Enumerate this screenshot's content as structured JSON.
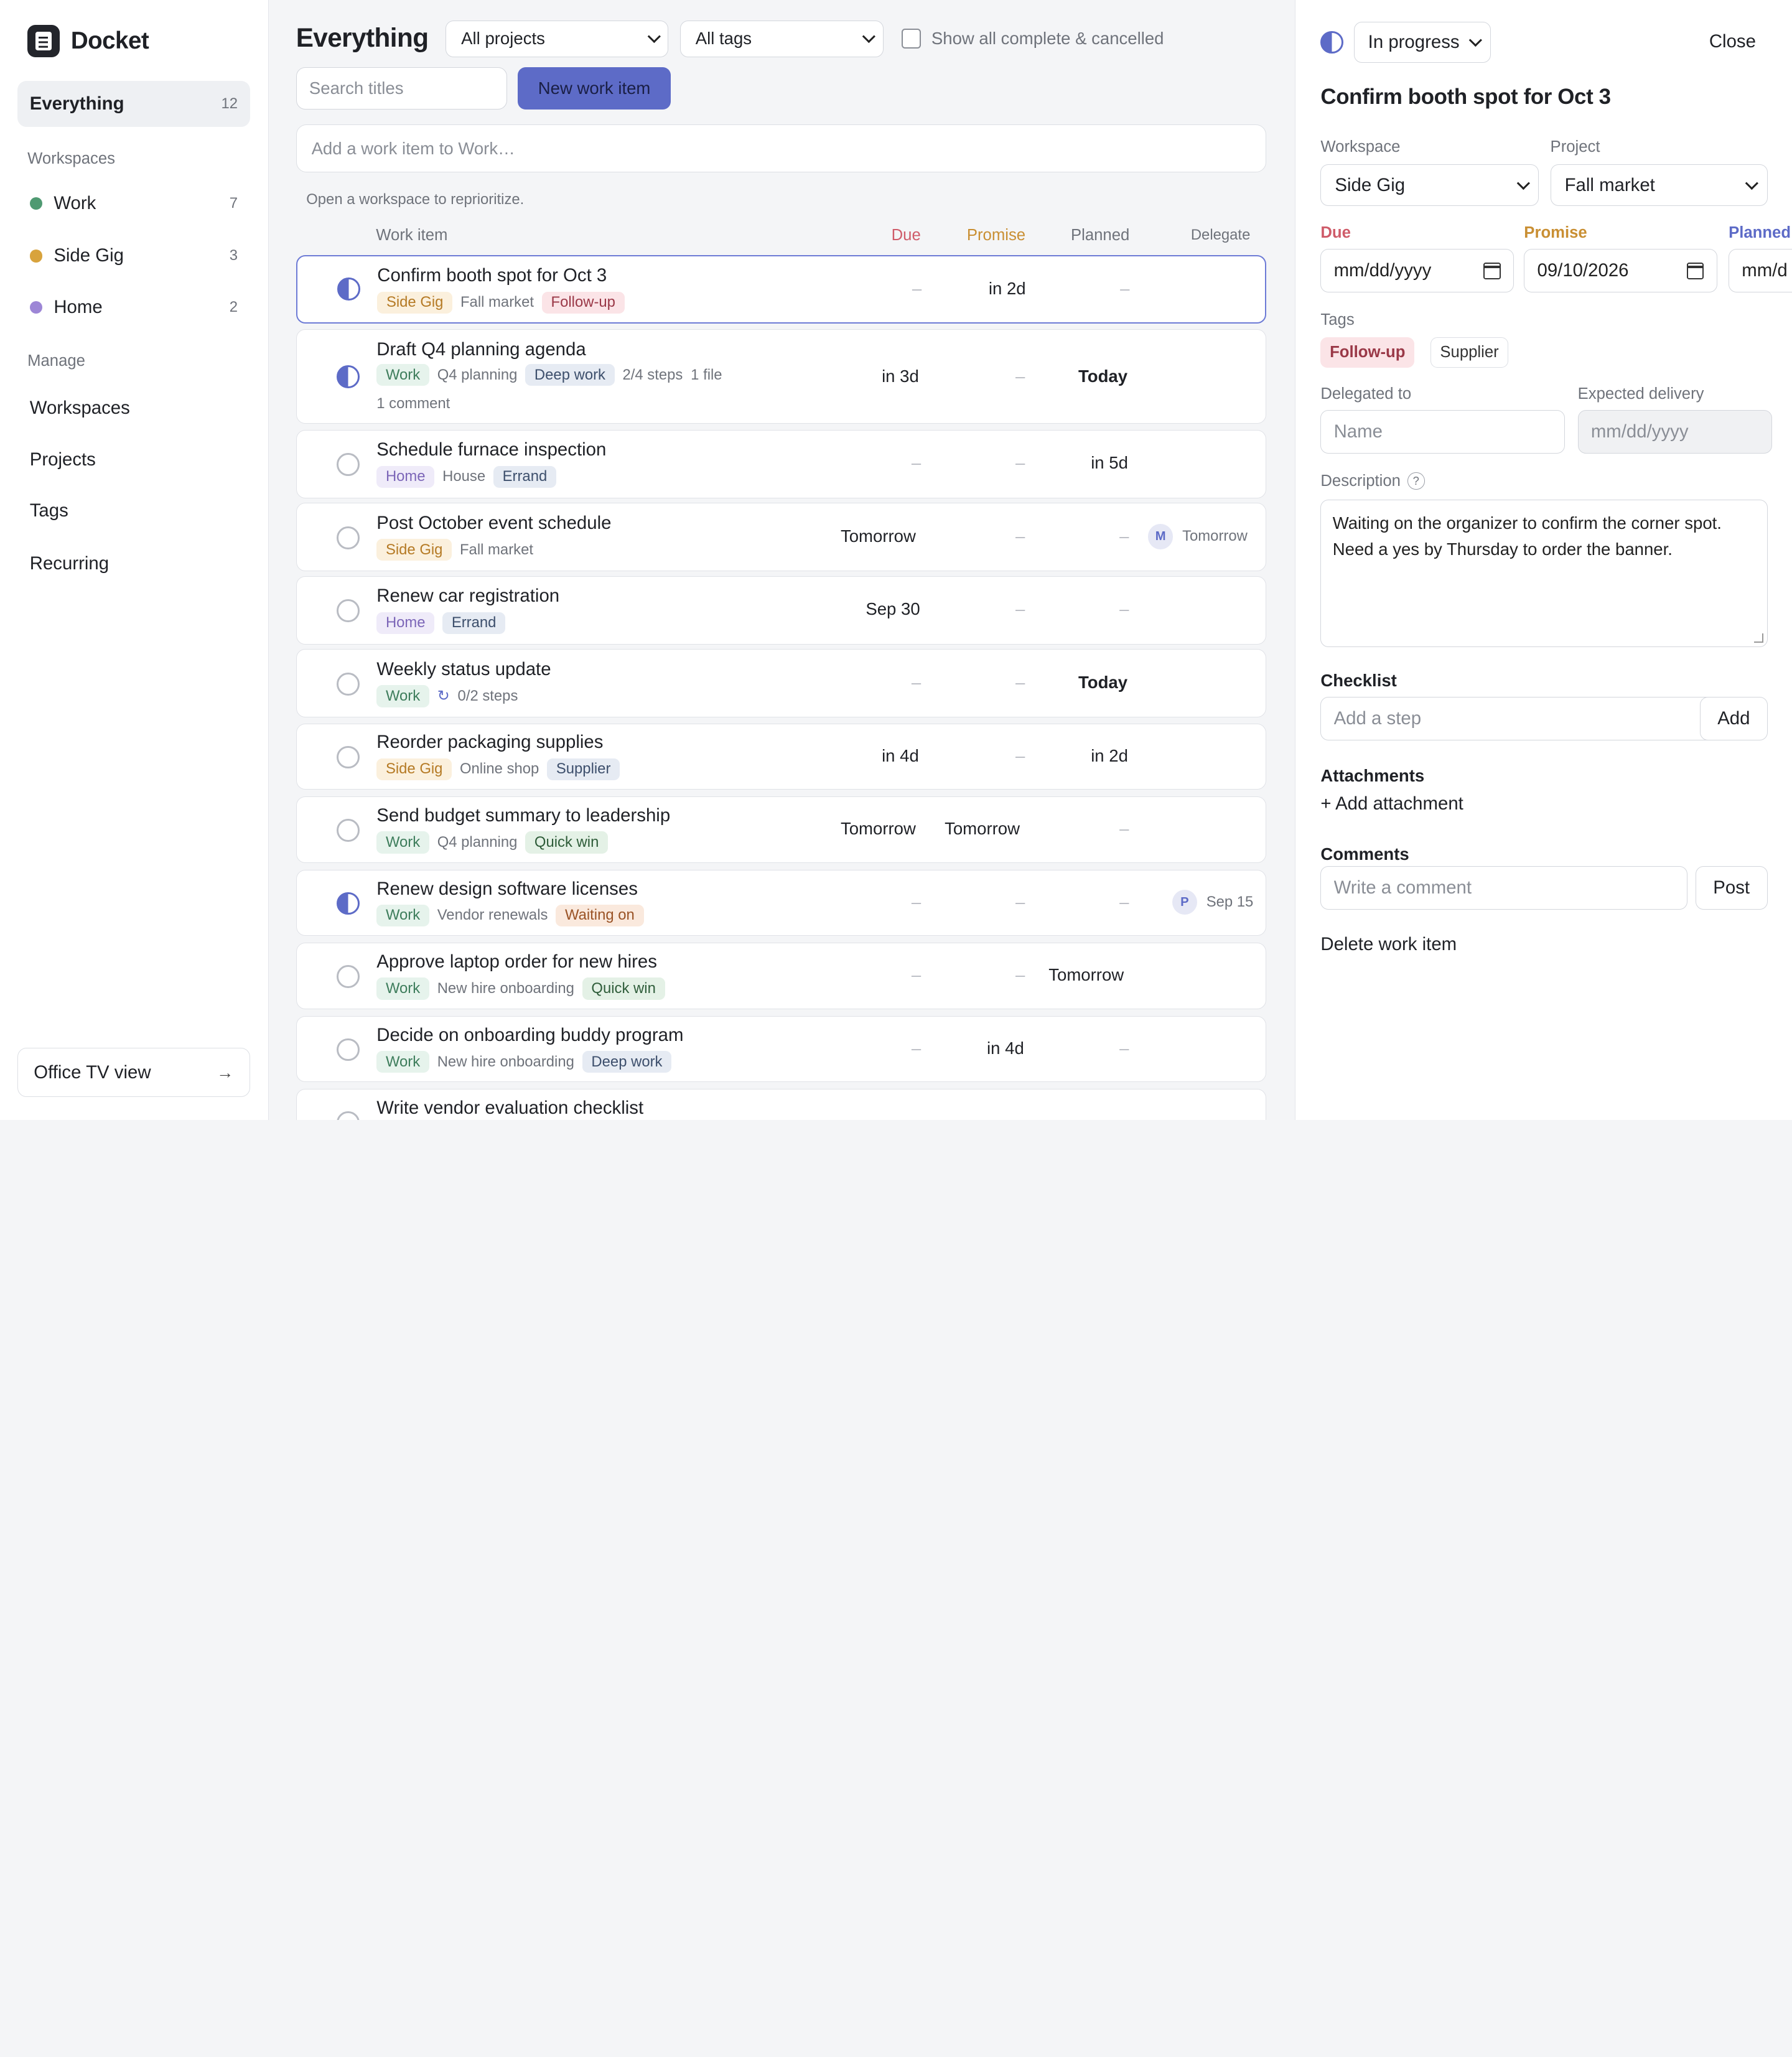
{
  "app": {
    "name": "Docket"
  },
  "sidebar": {
    "everything": {
      "label": "Everything",
      "count": "12"
    },
    "workspaces_title": "Workspaces",
    "workspaces": [
      {
        "label": "Work",
        "count": "7",
        "color": "#4f9a72"
      },
      {
        "label": "Side Gig",
        "count": "3",
        "color": "#d8a33d"
      },
      {
        "label": "Home",
        "count": "2",
        "color": "#9d86d6"
      }
    ],
    "manage_title": "Manage",
    "manage": [
      "Workspaces",
      "Projects",
      "Tags",
      "Recurring"
    ],
    "tv_view": {
      "label": "Office TV view",
      "arrow": "→"
    }
  },
  "main": {
    "title": "Everything",
    "project_filter": "All projects",
    "tag_filter": "All tags",
    "show_complete_label": "Show all complete & cancelled",
    "search_placeholder": "Search titles",
    "new_button": "New work item",
    "add_placeholder": "Add a work item to Work…",
    "hint": "Open a workspace to reprioritize.",
    "columns": {
      "work_item": "Work item",
      "due": "Due",
      "promise": "Promise",
      "planned": "Planned",
      "delegate": "Delegate"
    },
    "rows": [
      {
        "title": "Confirm booth spot for Oct 3",
        "workspace": "Side Gig",
        "project": "Fall market",
        "tags": [
          "Follow-up"
        ],
        "extra": "",
        "due": "–",
        "promise": "in 2d",
        "planned": "–",
        "delegate": "",
        "delegate_date": ""
      },
      {
        "title": "Draft Q4 planning agenda",
        "workspace": "Work",
        "project": "Q4 planning",
        "tags": [
          "Deep work"
        ],
        "extra": "2/4 steps",
        "extra2": "1 file",
        "extra3": "1 comment",
        "due": "in 3d",
        "promise": "–",
        "planned": "Today",
        "delegate": "",
        "delegate_date": ""
      },
      {
        "title": "Schedule furnace inspection",
        "workspace": "Home",
        "project": "House",
        "tags": [
          "Errand"
        ],
        "due": "–",
        "promise": "–",
        "planned": "in 5d"
      },
      {
        "title": "Post October event schedule",
        "workspace": "Side Gig",
        "project": "Fall market",
        "tags": [],
        "due": "Tomorrow",
        "promise": "–",
        "planned": "–",
        "delegate": "M",
        "delegate_date": "Tomorrow"
      },
      {
        "title": "Renew car registration",
        "workspace": "Home",
        "project": "",
        "tags": [
          "Errand"
        ],
        "due": "Sep 30",
        "promise": "–",
        "planned": "–"
      },
      {
        "title": "Weekly status update",
        "workspace": "Work",
        "recur_icon": "↻",
        "extra": "0/2 steps",
        "due": "–",
        "promise": "–",
        "planned": "Today"
      },
      {
        "title": "Reorder packaging supplies",
        "workspace": "Side Gig",
        "project": "Online shop",
        "tags": [
          "Supplier"
        ],
        "due": "in 4d",
        "promise": "–",
        "planned": "in 2d"
      },
      {
        "title": "Send budget summary to leadership",
        "workspace": "Work",
        "project": "Q4 planning",
        "tags": [
          "Quick win"
        ],
        "due": "Tomorrow",
        "promise": "Tomorrow",
        "planned": "–"
      },
      {
        "title": "Renew design software licenses",
        "workspace": "Work",
        "project": "Vendor renewals",
        "tags": [
          "Waiting on"
        ],
        "due": "–",
        "promise": "–",
        "planned": "–",
        "delegate": "P",
        "delegate_date": "Sep 15"
      },
      {
        "title": "Approve laptop order for new hires",
        "workspace": "Work",
        "project": "New hire onboarding",
        "tags": [
          "Quick win"
        ],
        "due": "–",
        "promise": "–",
        "planned": "Tomorrow"
      },
      {
        "title": "Decide on onboarding buddy program",
        "workspace": "Work",
        "project": "New hire onboarding",
        "tags": [
          "Deep work"
        ],
        "due": "–",
        "promise": "in 4d",
        "planned": "–"
      },
      {
        "title": "Write vendor evaluation checklist"
      }
    ]
  },
  "panel": {
    "status": "In progress",
    "close": "Close",
    "title": "Confirm booth spot for Oct 3",
    "workspace_label": "Workspace",
    "workspace_value": "Side Gig",
    "project_label": "Project",
    "project_value": "Fall market",
    "due_label": "Due",
    "due_value": "mm/dd/yyyy",
    "promise_label": "Promise",
    "promise_value": "09/10/2026",
    "planned_label": "Planned",
    "planned_value": "mm/d",
    "tags_label": "Tags",
    "tags": [
      "Follow-up",
      "Supplier"
    ],
    "delegated_label": "Delegated to",
    "delegated_placeholder": "Name",
    "expected_label": "Expected delivery",
    "expected_value": "mm/dd/yyyy",
    "description_label": "Description",
    "description_help": "?",
    "description": "Waiting on the organizer to confirm the corner spot. Need a yes by Thursday to order the banner.",
    "checklist_label": "Checklist",
    "checklist_placeholder": "Add a step",
    "checklist_add": "Add",
    "attachments_label": "Attachments",
    "add_attachment": "+ Add attachment",
    "comments_label": "Comments",
    "comment_placeholder": "Write a comment",
    "post": "Post",
    "delete": "Delete work item"
  }
}
